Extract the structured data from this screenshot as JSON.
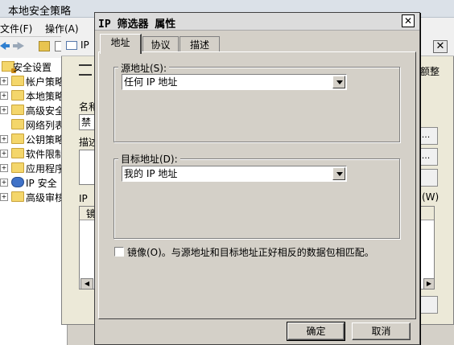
{
  "main_window": {
    "title": "本地安全策略",
    "menu": [
      "文件(F)",
      "操作(A)"
    ],
    "tree": [
      {
        "label": "安全设置",
        "icon": "lock-icon",
        "expander": ""
      },
      {
        "label": "帐户策略",
        "icon": "folder-icon",
        "expander": "+"
      },
      {
        "label": "本地策略",
        "icon": "folder-icon",
        "expander": "+"
      },
      {
        "label": "高级安全",
        "icon": "folder-icon",
        "expander": "+"
      },
      {
        "label": "网络列表",
        "icon": "folder-icon",
        "expander": ""
      },
      {
        "label": "公钥策略",
        "icon": "folder-icon",
        "expander": "+"
      },
      {
        "label": "软件限制",
        "icon": "folder-icon",
        "expander": "+"
      },
      {
        "label": "应用程序",
        "icon": "folder-icon",
        "expander": "+"
      },
      {
        "label": "IP 安全",
        "icon": "shield-icon",
        "expander": "+"
      },
      {
        "label": "高级审核",
        "icon": "folder-icon",
        "expander": "+"
      }
    ]
  },
  "bg_dialog": {
    "title_fragment": "IP",
    "right_label": "额整",
    "name_label": "名和",
    "name_value": "禁",
    "desc_label": "描述",
    "ip_label": "IP",
    "w_label": "(W)",
    "col_header": "镜",
    "dots": "..."
  },
  "dialog": {
    "title": "IP 筛选器 属性",
    "close_glyph": "✕",
    "tabs": [
      {
        "label": "地址",
        "active": true
      },
      {
        "label": "协议",
        "active": false
      },
      {
        "label": "描述",
        "active": false
      }
    ],
    "source": {
      "label": "源地址(S):",
      "value": "任何 IP 地址"
    },
    "destination": {
      "label": "目标地址(D):",
      "value": "我的 IP 地址"
    },
    "mirror": {
      "checked": false,
      "label": "镜像(O)。与源地址和目标地址正好相反的数据包相匹配。"
    },
    "ok_label": "确定",
    "cancel_label": "取消"
  }
}
